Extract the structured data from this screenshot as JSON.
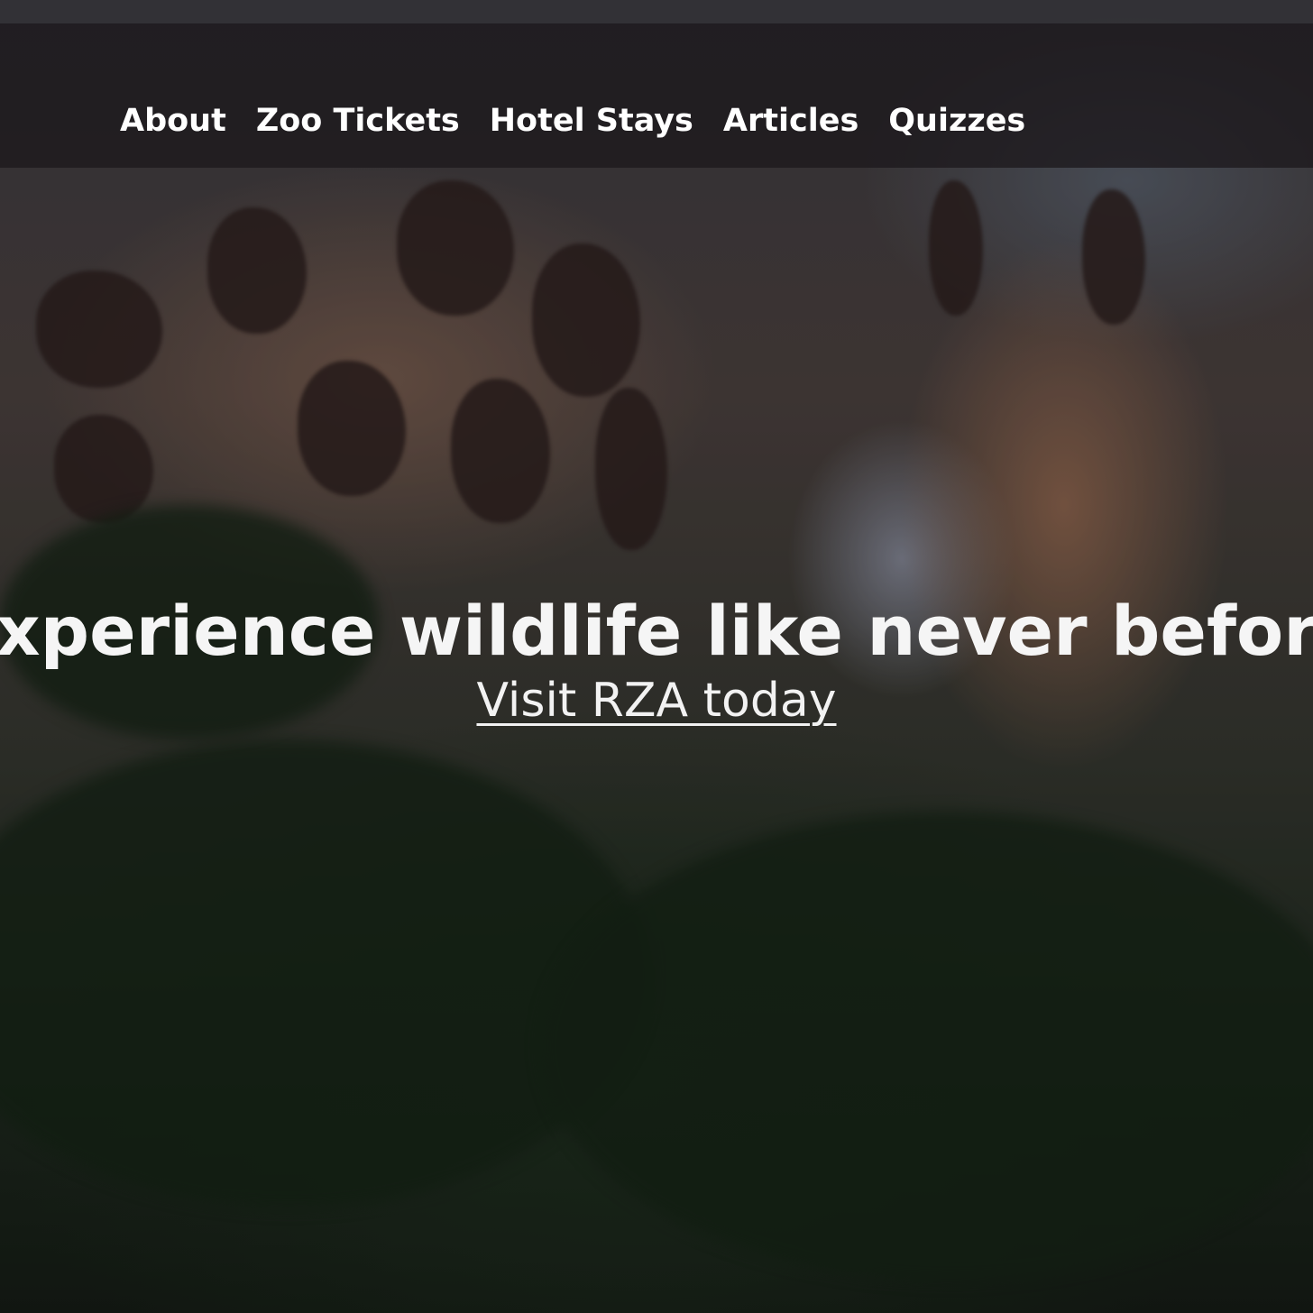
{
  "nav": {
    "links": [
      {
        "label": "About"
      },
      {
        "label": "Zoo Tickets"
      },
      {
        "label": "Hotel Stays"
      },
      {
        "label": "Articles"
      },
      {
        "label": "Quizzes"
      }
    ]
  },
  "hero": {
    "headline": "Experience wildlife like never before",
    "cta_label": "Visit RZA today"
  },
  "colors": {
    "nav_text": "#ffffff",
    "headline_text": "#f5f5f5",
    "navbar_background": "#1c181c"
  }
}
